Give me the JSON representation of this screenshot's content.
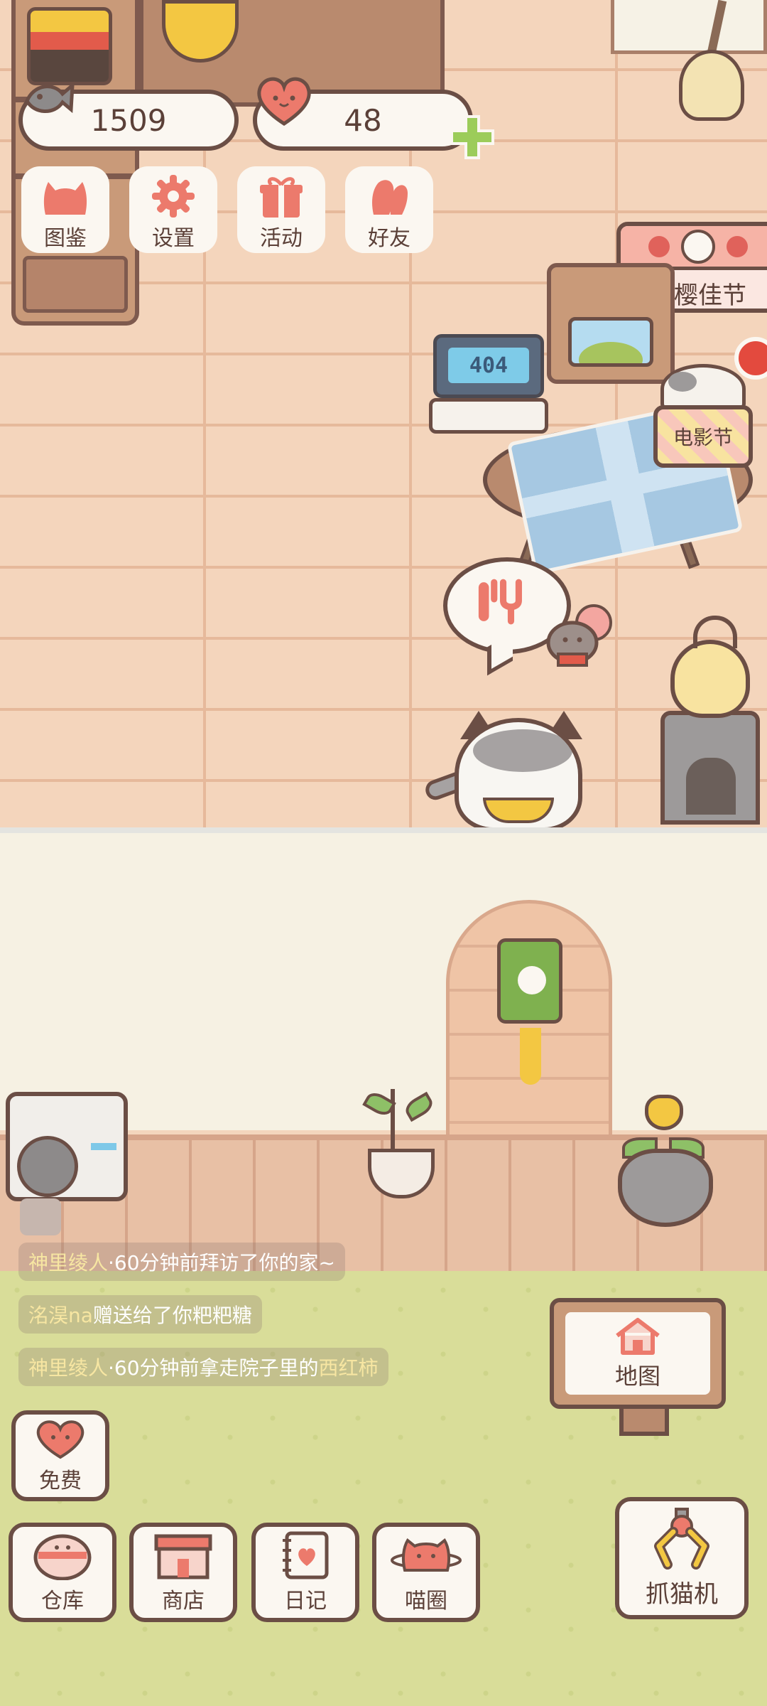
{
  "hud": {
    "fish_count": "1509",
    "heart_count": "48"
  },
  "menu": {
    "atlas": "图鉴",
    "settings": "设置",
    "events": "活动",
    "friends": "好友"
  },
  "festival": {
    "label": "赏樱佳节"
  },
  "laptop": {
    "screen_text": "404"
  },
  "movie": {
    "label": "电影节"
  },
  "notices": {
    "n1_name": "神里绫人",
    "n1_text": "·60分钟前拜访了你的家~",
    "n2_name": "洺淏na",
    "n2_text": "赠送给了你粑粑糖",
    "n3_name": "神里绫人",
    "n3_text": "·60分钟前拿走院子里的",
    "n3_item": "西红柿"
  },
  "map": {
    "label": "地图"
  },
  "bottom": {
    "free": "免费",
    "storage": "仓库",
    "shop": "商店",
    "diary": "日记",
    "circle": "喵圈",
    "claw": "抓猫机"
  },
  "colors": {
    "outline": "#6b4e45",
    "wall": "#f4d5bc",
    "grass": "#d9dd99",
    "accent_red": "#e0625b",
    "accent_yellow": "#f3c742"
  }
}
